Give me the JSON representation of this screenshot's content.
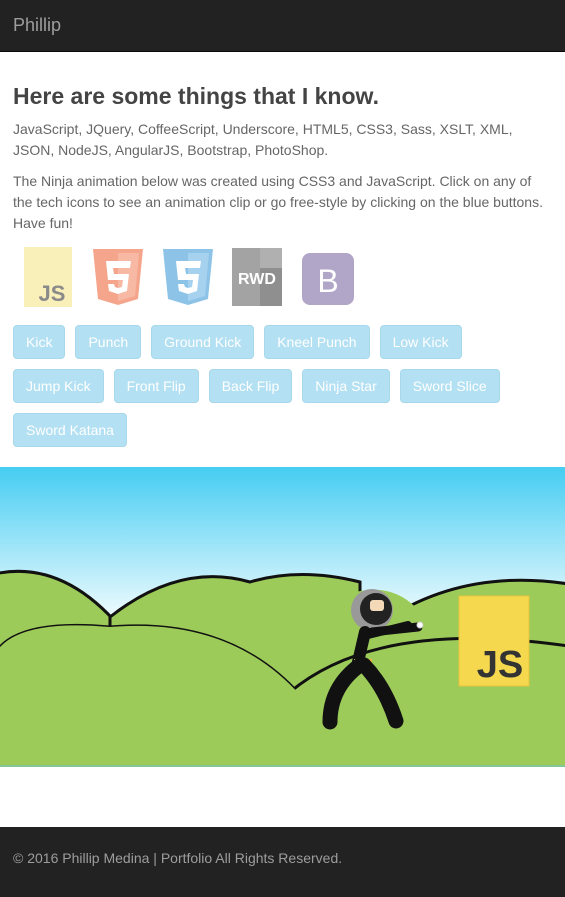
{
  "navbar": {
    "brand": "Phillip"
  },
  "main": {
    "heading": "Here are some things that I know.",
    "skills_text": "JavaScript, JQuery, CoffeeScript, Underscore, HTML5, CSS3, Sass, XSLT, XML, JSON, NodeJS, AngularJS, Bootstrap, PhotoShop.",
    "instructions": "The Ninja animation below was created using CSS3 and JavaScript. Click on any of the tech icons to see an animation clip or go free-style by clicking on the blue buttons. Have fun!"
  },
  "tech_icons": [
    {
      "name": "javascript-icon",
      "label": "JS",
      "color": "#f7df1e"
    },
    {
      "name": "html5-icon",
      "label": "5",
      "color": "#e44d26"
    },
    {
      "name": "css3-icon",
      "label": "3",
      "color": "#1572b6"
    },
    {
      "name": "rwd-icon",
      "label": "RWD",
      "color": "#7a7a7a"
    },
    {
      "name": "bootstrap-icon",
      "label": "B",
      "color": "#563d7c"
    }
  ],
  "buttons": {
    "kick": "Kick",
    "punch": "Punch",
    "ground_kick": "Ground Kick",
    "kneel_punch": "Kneel Punch",
    "low_kick": "Low Kick",
    "jump_kick": "Jump Kick",
    "front_flip": "Front Flip",
    "back_flip": "Back Flip",
    "ninja_star": "Ninja Star",
    "sword_slice": "Sword Slice",
    "sword_katana": "Sword Katana"
  },
  "scene": {
    "sign_label": "JS",
    "sky_top": "#45cdf2",
    "sky_bottom": "#ffffff",
    "grass": "#9ccb5a"
  },
  "footer": {
    "text": "© 2016 Phillip Medina | Portfolio All Rights Reserved."
  }
}
